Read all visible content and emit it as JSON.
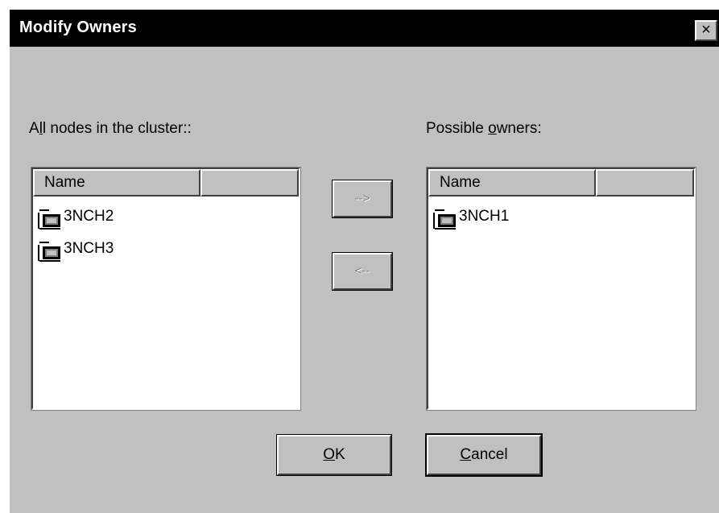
{
  "dialog": {
    "title": "Modify Owners",
    "close_glyph": "×"
  },
  "left": {
    "label_mnemonic": "l",
    "label_pre": "A",
    "label_post": "l nodes in the cluster::",
    "column_name": "Name",
    "items": [
      "3NCH2",
      "3NCH3"
    ]
  },
  "right": {
    "label_pre": "Possible ",
    "label_mnemonic": "o",
    "label_post": "wners:",
    "column_name": "Name",
    "items": [
      "3NCH1"
    ]
  },
  "buttons": {
    "add_label": "-->",
    "remove_label": "<--",
    "ok_mnemonic": "O",
    "ok_rest": "K",
    "cancel_mnemonic": "C",
    "cancel_rest": "ancel"
  },
  "icons": {
    "node": "cluster-node-icon",
    "close": "close-icon"
  },
  "colors": {
    "face": "#c0c0c0",
    "titlebar": "#000000",
    "window": "#ffffff"
  }
}
